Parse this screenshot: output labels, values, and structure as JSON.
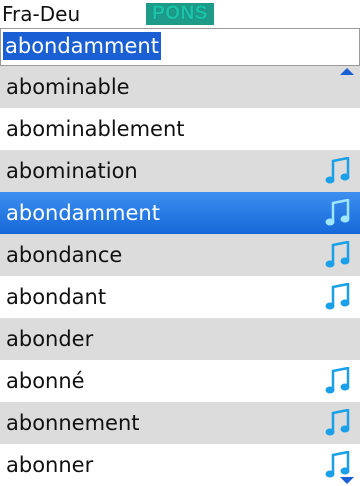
{
  "header": {
    "language_pair": "Fra-Deu",
    "logo_text": "PONS"
  },
  "search": {
    "value": "abondamment"
  },
  "entries": [
    {
      "word": "abominable",
      "audio": false,
      "selected": false
    },
    {
      "word": "abominablement",
      "audio": false,
      "selected": false
    },
    {
      "word": "abomination",
      "audio": true,
      "selected": false
    },
    {
      "word": "abondamment",
      "audio": true,
      "selected": true
    },
    {
      "word": "abondance",
      "audio": true,
      "selected": false
    },
    {
      "word": "abondant",
      "audio": true,
      "selected": false
    },
    {
      "word": "abonder",
      "audio": false,
      "selected": false
    },
    {
      "word": "abonné",
      "audio": true,
      "selected": false
    },
    {
      "word": "abonnement",
      "audio": true,
      "selected": false
    },
    {
      "word": "abonner",
      "audio": true,
      "selected": false
    }
  ],
  "icons": {
    "audio": "music-note-icon",
    "scroll_up": "scroll-up-arrow-icon",
    "scroll_down": "scroll-down-arrow-icon"
  },
  "colors": {
    "selection": "#1a5fd4",
    "row_alt": "#dcdcdc",
    "audio_icon": "#1aa0e8",
    "logo_bg": "#1f9b8a"
  }
}
